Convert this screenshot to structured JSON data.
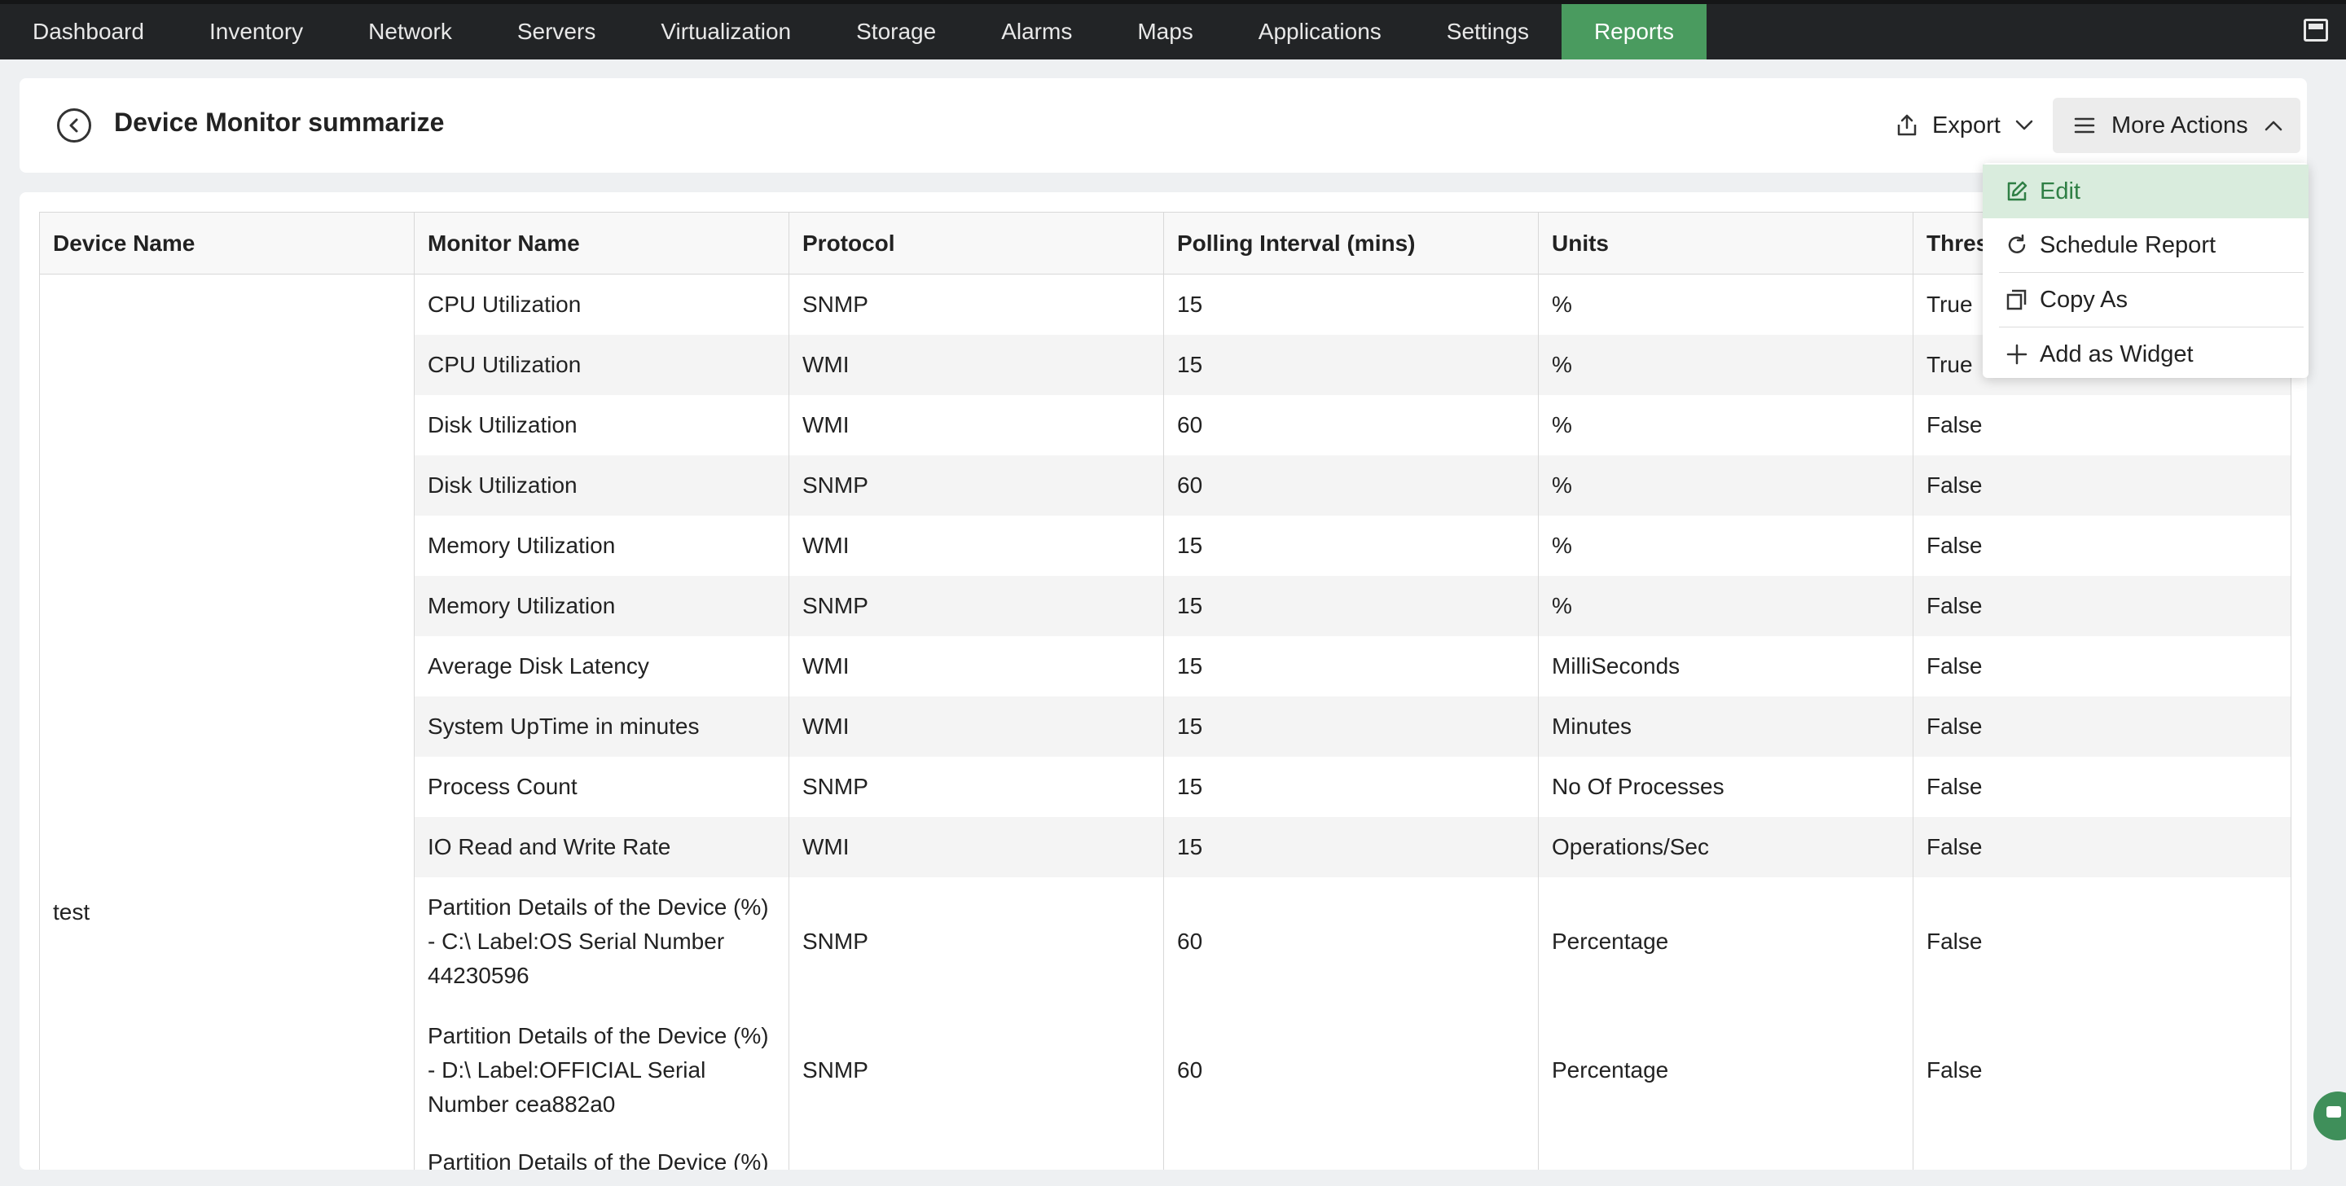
{
  "nav": {
    "items": [
      {
        "label": "Dashboard",
        "active": false
      },
      {
        "label": "Inventory",
        "active": false
      },
      {
        "label": "Network",
        "active": false
      },
      {
        "label": "Servers",
        "active": false
      },
      {
        "label": "Virtualization",
        "active": false
      },
      {
        "label": "Storage",
        "active": false
      },
      {
        "label": "Alarms",
        "active": false
      },
      {
        "label": "Maps",
        "active": false
      },
      {
        "label": "Applications",
        "active": false
      },
      {
        "label": "Settings",
        "active": false
      },
      {
        "label": "Reports",
        "active": true
      }
    ],
    "right_icon": "window-icon",
    "active_color": "#4a9b5f"
  },
  "header": {
    "title": "Device Monitor summarize",
    "back_icon": "back-arrow-circle-icon",
    "export_label": "Export",
    "more_actions_label": "More Actions"
  },
  "dropdown": {
    "items": [
      {
        "label": "Edit",
        "icon": "edit-icon"
      },
      {
        "label": "Schedule Report",
        "icon": "schedule-icon"
      },
      {
        "label": "Copy As",
        "icon": "copy-icon"
      },
      {
        "label": "Add as Widget",
        "icon": "plus-icon"
      }
    ]
  },
  "table": {
    "columns": [
      "Device Name",
      "Monitor Name",
      "Protocol",
      "Polling Interval (mins)",
      "Units",
      "Thres"
    ],
    "device": "test",
    "rows": [
      {
        "monitor": "CPU Utilization",
        "protocol": "SNMP",
        "interval": "15",
        "units": "%",
        "threshold": "True"
      },
      {
        "monitor": "CPU Utilization",
        "protocol": "WMI",
        "interval": "15",
        "units": "%",
        "threshold": "True"
      },
      {
        "monitor": "Disk Utilization",
        "protocol": "WMI",
        "interval": "60",
        "units": "%",
        "threshold": "False"
      },
      {
        "monitor": "Disk Utilization",
        "protocol": "SNMP",
        "interval": "60",
        "units": "%",
        "threshold": "False"
      },
      {
        "monitor": "Memory Utilization",
        "protocol": "WMI",
        "interval": "15",
        "units": "%",
        "threshold": "False"
      },
      {
        "monitor": "Memory Utilization",
        "protocol": "SNMP",
        "interval": "15",
        "units": "%",
        "threshold": "False"
      },
      {
        "monitor": "Average Disk Latency",
        "protocol": "WMI",
        "interval": "15",
        "units": "MilliSeconds",
        "threshold": "False"
      },
      {
        "monitor": "System UpTime in minutes",
        "protocol": "WMI",
        "interval": "15",
        "units": "Minutes",
        "threshold": "False"
      },
      {
        "monitor": "Process Count",
        "protocol": "SNMP",
        "interval": "15",
        "units": "No Of Processes",
        "threshold": "False"
      },
      {
        "monitor": "IO Read and Write Rate",
        "protocol": "WMI",
        "interval": "15",
        "units": "Operations/Sec",
        "threshold": "False"
      },
      {
        "monitor": "Partition Details of the Device (%) - C:\\ Label:OS Serial Number 44230596",
        "protocol": "SNMP",
        "interval": "60",
        "units": "Percentage",
        "threshold": "False"
      },
      {
        "monitor": "Partition Details of the Device (%) - D:\\ Label:OFFICIAL Serial Number cea882a0",
        "protocol": "SNMP",
        "interval": "60",
        "units": "Percentage",
        "threshold": "False"
      },
      {
        "monitor": "Partition Details of the Device (%)",
        "protocol": "",
        "interval": "",
        "units": "",
        "threshold": ""
      }
    ]
  },
  "chat_icon": "chat-icon"
}
